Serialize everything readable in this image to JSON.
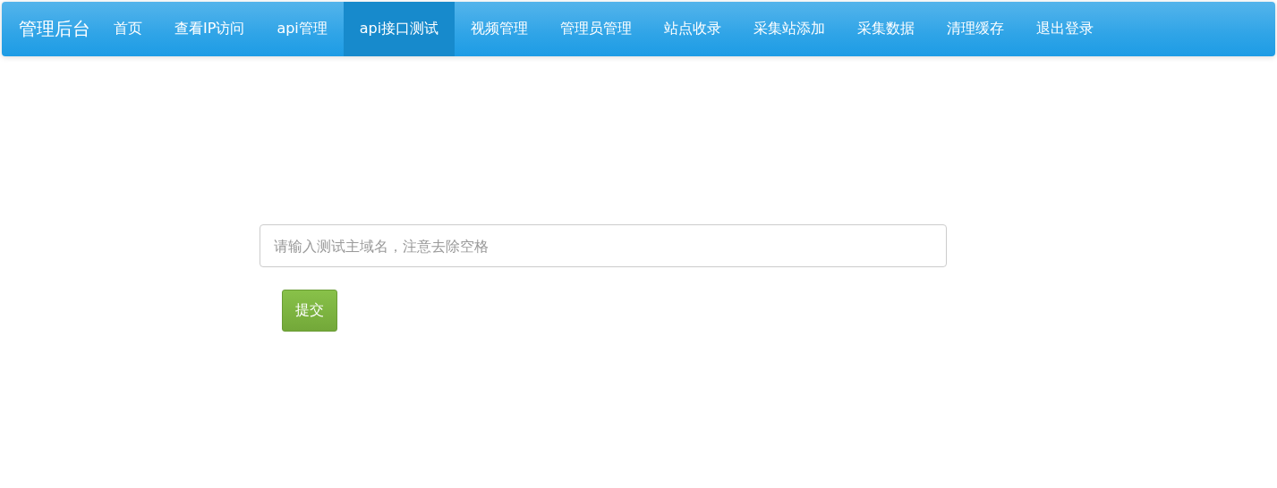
{
  "navbar": {
    "brand": "管理后台",
    "items": [
      {
        "label": "首页",
        "selected": false
      },
      {
        "label": "查看IP访问",
        "selected": false
      },
      {
        "label": "api管理",
        "selected": false
      },
      {
        "label": "api接口测试",
        "selected": true
      },
      {
        "label": "视频管理",
        "selected": false
      },
      {
        "label": "管理员管理",
        "selected": false
      },
      {
        "label": "站点收录",
        "selected": false
      },
      {
        "label": "采集站添加",
        "selected": false
      },
      {
        "label": "采集数据",
        "selected": false
      },
      {
        "label": "清理缓存",
        "selected": false
      },
      {
        "label": "退出登录",
        "selected": false
      }
    ]
  },
  "form": {
    "domain_field": {
      "placeholder": "请输入测试主域名，注意去除空格"
    },
    "submit": "提交"
  }
}
